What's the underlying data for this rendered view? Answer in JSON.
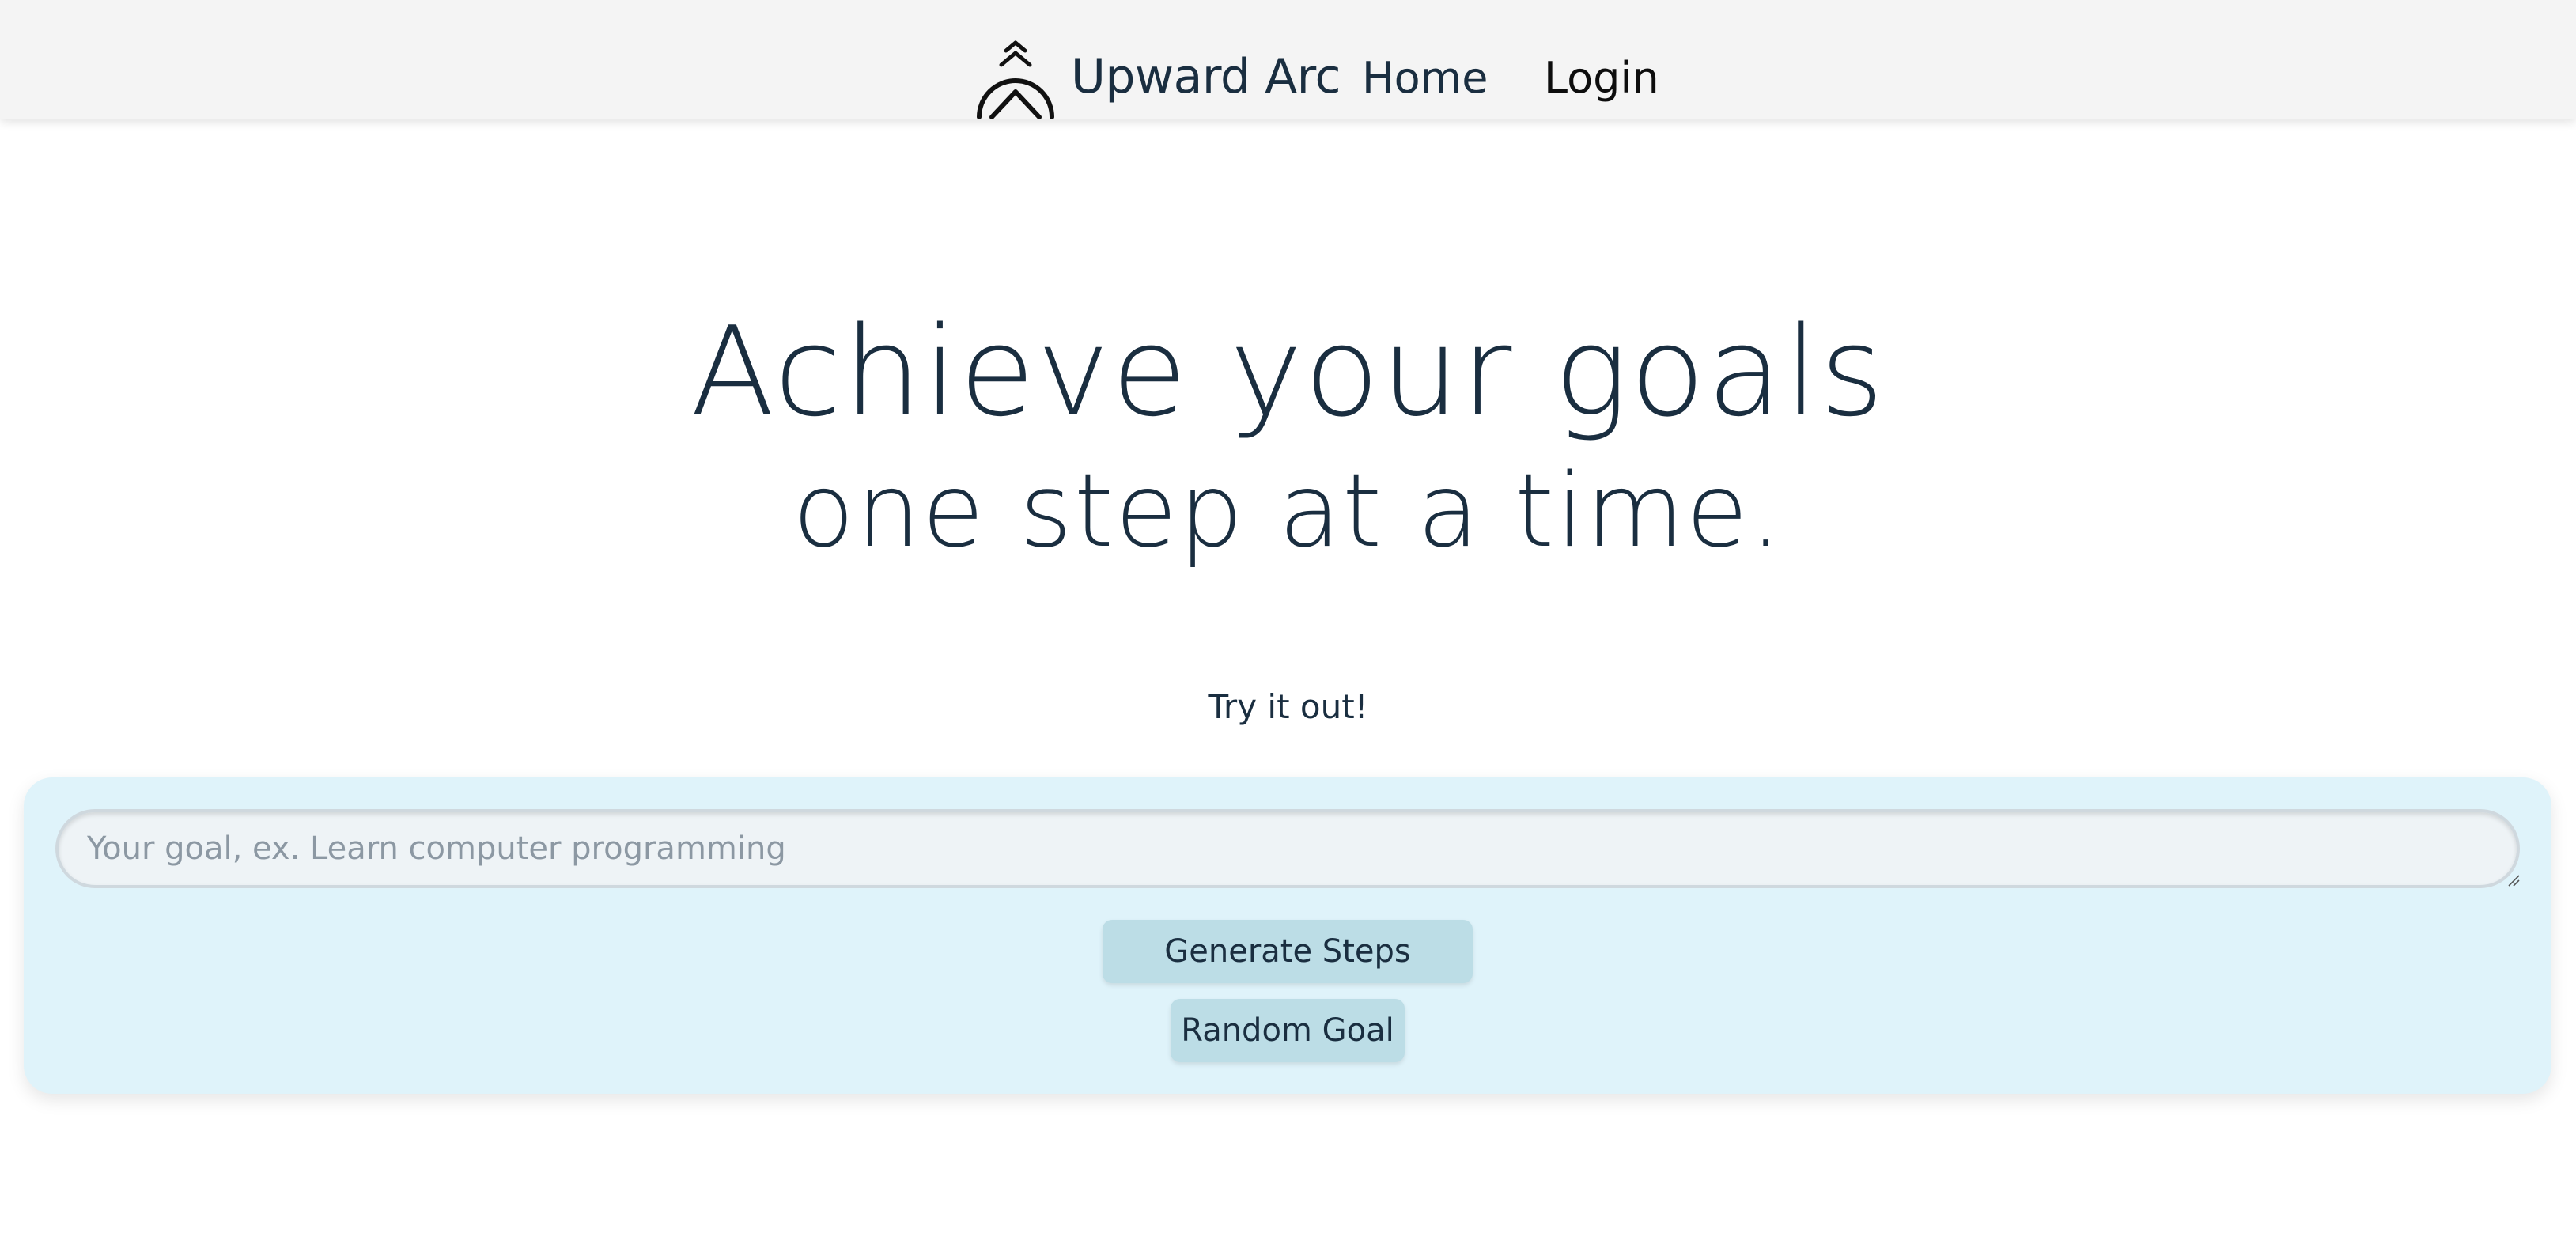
{
  "nav": {
    "brand": "Upward Arc",
    "links": [
      {
        "label": "Home"
      },
      {
        "label": "Login"
      }
    ]
  },
  "hero": {
    "title": "Achieve your goals",
    "subtitle": "one step at a time."
  },
  "tryit": {
    "label": "Try it out!"
  },
  "goal_form": {
    "value": "",
    "placeholder": "Your goal, ex. Learn computer programming",
    "generate_label": "Generate Steps",
    "random_label": "Random Goal"
  },
  "colors": {
    "text": "#1a2e40",
    "navbar_bg": "#f4f4f4",
    "panel_bg": "#dff3fa",
    "button_bg": "#bcdde6",
    "input_bg": "#eef3f6"
  },
  "icons": {
    "logo": "upward-chevron-arc-icon"
  }
}
